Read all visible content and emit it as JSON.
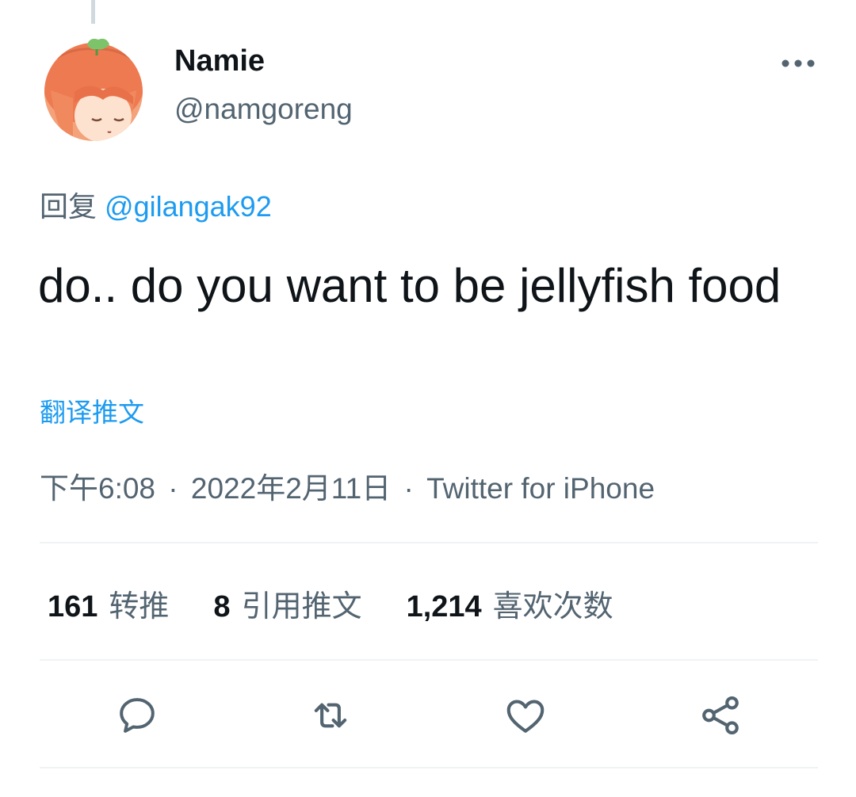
{
  "tweet": {
    "author": {
      "name": "Namie",
      "handle": "@namgoreng"
    },
    "reply": {
      "prefix": "回复",
      "mention": "@gilangak92"
    },
    "text": "do.. do you want to be jellyfish food",
    "translate_label": "翻译推文",
    "meta": {
      "time": "下午6:08",
      "date": "2022年2月11日",
      "source": "Twitter for iPhone",
      "separator": "·"
    }
  },
  "stats": [
    {
      "count": "161",
      "label": "转推"
    },
    {
      "count": "8",
      "label": "引用推文"
    },
    {
      "count": "1,214",
      "label": "喜欢次数"
    }
  ],
  "icons": {
    "more": "more-horizontal-icon",
    "reply": "reply-icon",
    "retweet": "retweet-icon",
    "like": "heart-icon",
    "share": "share-icon"
  },
  "colors": {
    "text_primary": "#0f1419",
    "text_secondary": "#536471",
    "link": "#1d9bf0",
    "divider": "#eff3f4"
  }
}
